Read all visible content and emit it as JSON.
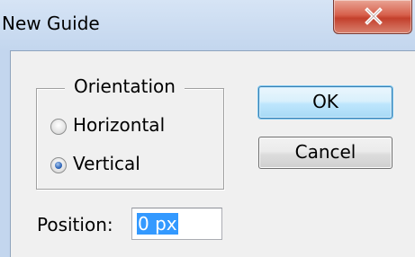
{
  "window": {
    "title": "New Guide"
  },
  "orientation": {
    "legend": "Orientation",
    "options": [
      {
        "label": "Horizontal",
        "selected": false
      },
      {
        "label": "Vertical",
        "selected": true
      }
    ]
  },
  "buttons": {
    "ok": "OK",
    "cancel": "Cancel"
  },
  "position": {
    "label": "Position:",
    "value": "0 px"
  },
  "colors": {
    "title_bar": "#c3d6ee",
    "close_button": "#c3402c",
    "selection": "#3399ff",
    "default_button_border": "#3c7fb1"
  }
}
